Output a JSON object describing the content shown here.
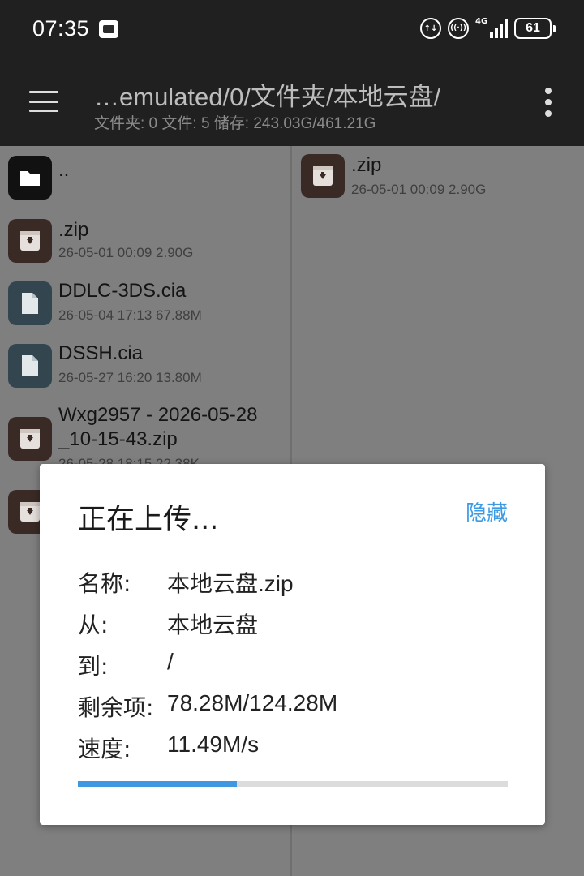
{
  "status_bar": {
    "time": "07:35",
    "battery": "61",
    "network": "4G",
    "data_badge": "1"
  },
  "toolbar": {
    "path": "…emulated/0/文件夹/本地云盘/",
    "stats": "文件夹: 0  文件: 5  储存: 243.03G/461.21G"
  },
  "left_pane": {
    "items": [
      {
        "name": "..",
        "meta": "",
        "icon": "folder-icon"
      },
      {
        "name": ".zip",
        "meta": "26-05-01 00:09  2.90G",
        "icon": "archive-icon"
      },
      {
        "name": "DDLC-3DS.cia",
        "meta": "26-05-04 17:13  67.88M",
        "icon": "file-icon"
      },
      {
        "name": "DSSH.cia",
        "meta": "26-05-27 16:20  13.80M",
        "icon": "file-icon"
      },
      {
        "name": "Wxg2957 - 2026-05-28",
        "name2": "_10-15-43.zip",
        "meta": "26-05-28 18:15  22.38K",
        "icon": "archive-icon"
      },
      {
        "name": "",
        "meta": "",
        "icon": "archive-icon"
      }
    ]
  },
  "right_pane": {
    "items": [
      {
        "name": ".zip",
        "meta": "26-05-01 00:09  2.90G",
        "icon": "archive-icon"
      }
    ]
  },
  "dialog": {
    "title": "正在上传...",
    "hide_label": "隐藏",
    "rows": [
      {
        "label": "名称:",
        "value": "本地云盘.zip"
      },
      {
        "label": "从:",
        "value": "本地云盘"
      },
      {
        "label": "到:",
        "value": "/"
      },
      {
        "label": "剩余项:",
        "value": "78.28M/124.28M"
      },
      {
        "label": "速度:",
        "value": "11.49M/s"
      }
    ],
    "progress_fraction": 0.37,
    "accent_color": "#3f97e0"
  }
}
